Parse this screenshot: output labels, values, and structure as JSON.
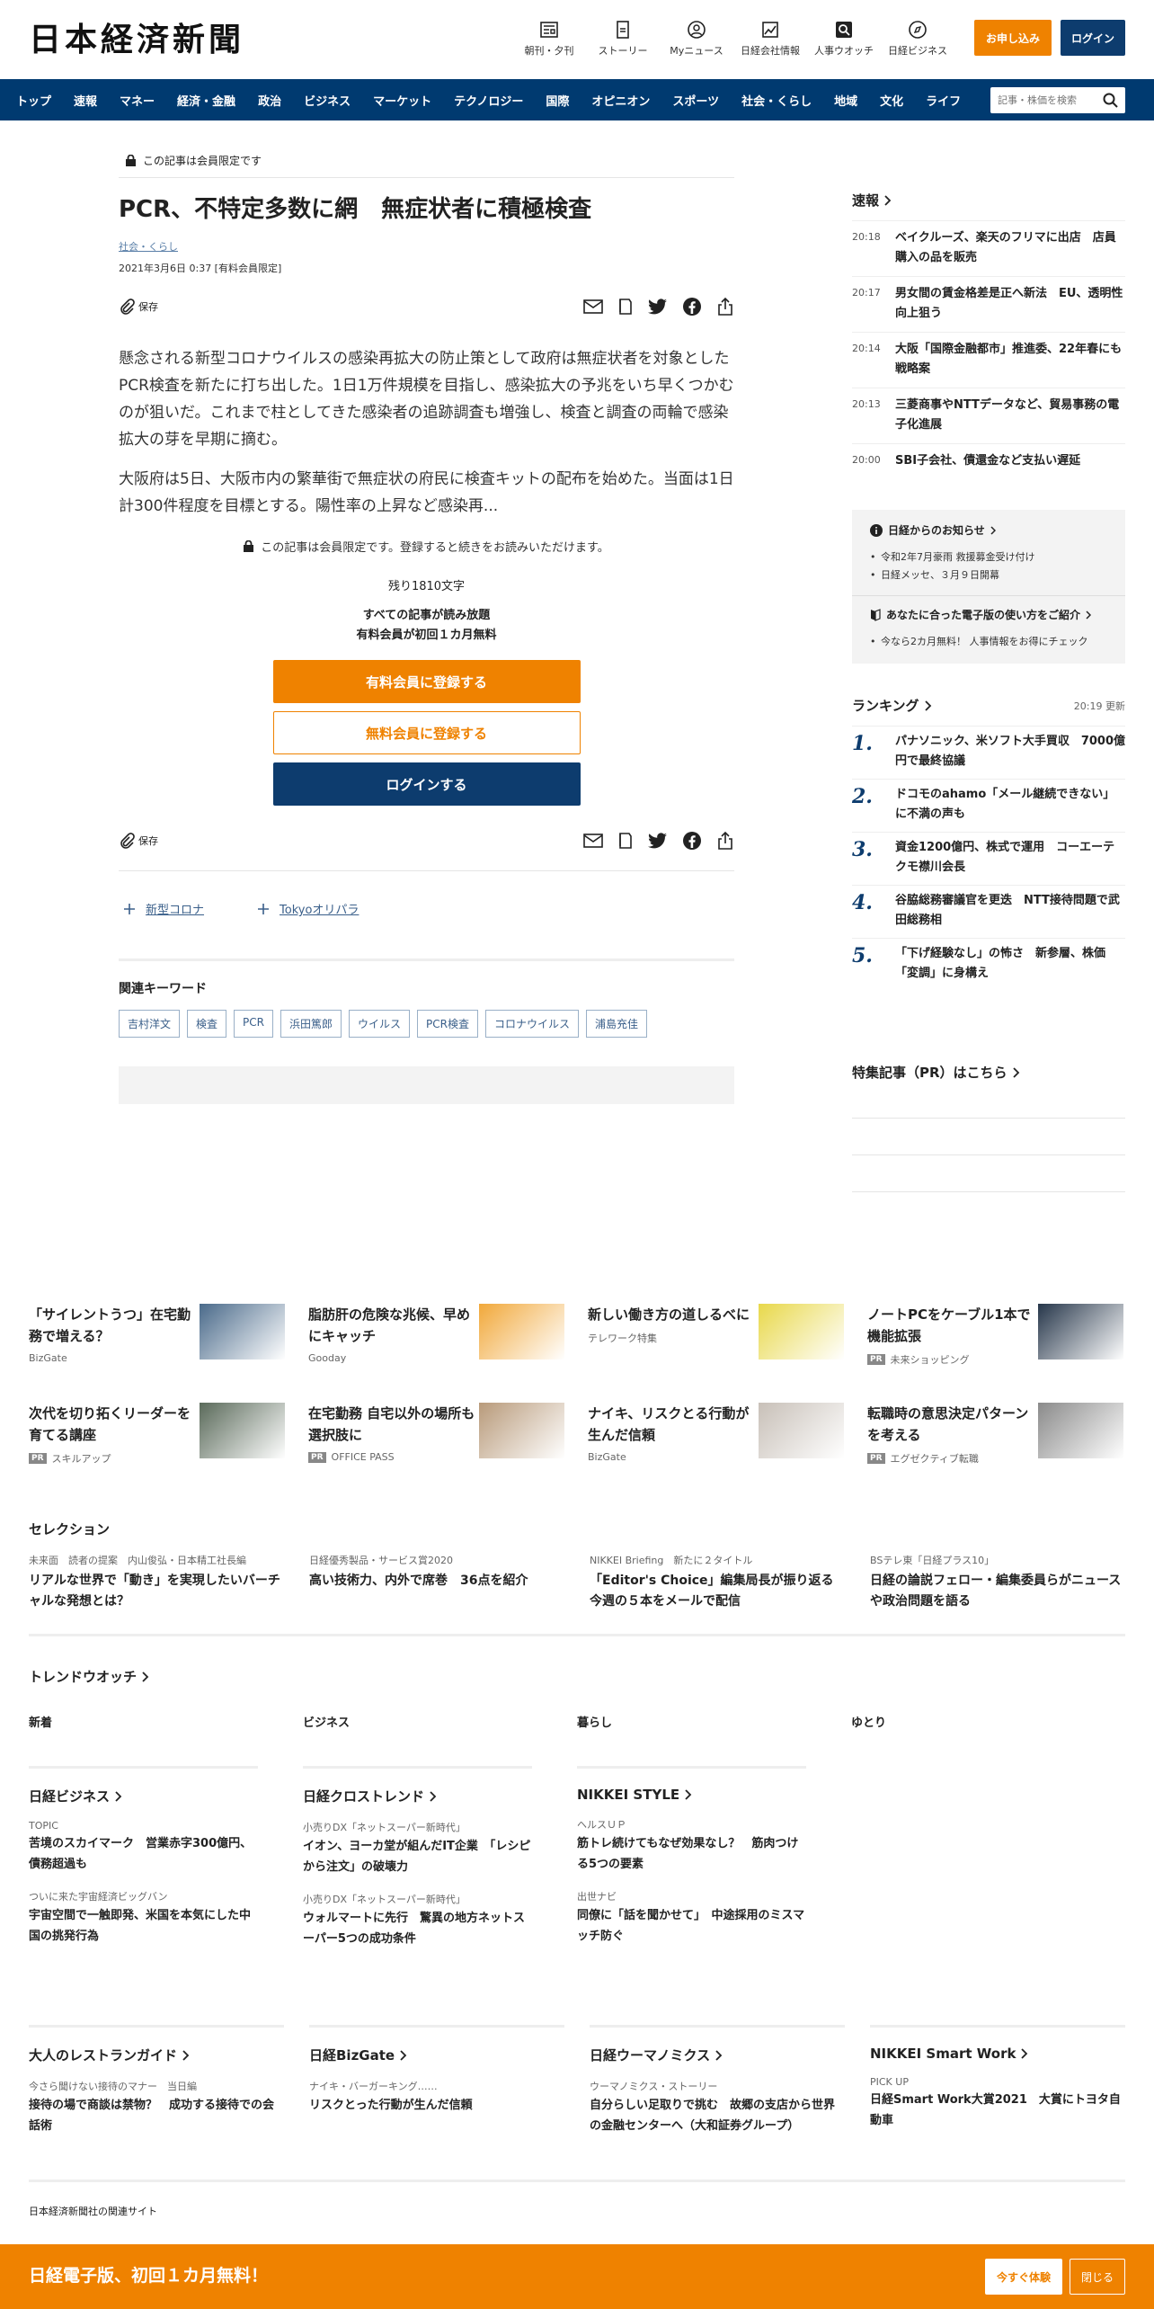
{
  "header": {
    "logo": "日本経済新聞",
    "tools": [
      {
        "label": "朝刊・夕刊",
        "icon": "newspaper-icon"
      },
      {
        "label": "ストーリー",
        "icon": "story-icon"
      },
      {
        "label": "Myニュース",
        "icon": "user-icon"
      },
      {
        "label": "日経会社情報",
        "icon": "chart-icon"
      },
      {
        "label": "人事ウオッチ",
        "icon": "search-person-icon"
      },
      {
        "label": "日経ビジネス",
        "icon": "compass-icon"
      }
    ],
    "apply_label": "お申し込み",
    "login_label": "ログイン"
  },
  "nav": {
    "items": [
      "トップ",
      "速報",
      "マネー",
      "経済・金融",
      "政治",
      "ビジネス",
      "マーケット",
      "テクノロジー",
      "国際",
      "オピニオン",
      "スポーツ",
      "社会・くらし",
      "地域",
      "文化",
      "ライフ"
    ],
    "search_placeholder": "記事・株価を検索"
  },
  "article": {
    "member_only": "この記事は会員限定です",
    "title": "PCR、不特定多数に網　無症状者に積極検査",
    "category": "社会・くらし",
    "date": "2021年3月6日 0:37 [有料会員限定]",
    "save_label": "保存",
    "para1": "懸念される新型コロナウイルスの感染再拡大の防止策として政府は無症状者を対象としたPCR検査を新たに打ち出した。1日1万件規模を目指し、感染拡大の予兆をいち早くつかむのが狙いだ。これまで柱としてきた感染者の追跡調査も増強し、検査と調査の両輪で感染拡大の芽を早期に摘む。",
    "para2": "大阪府は5日、大阪市内の繁華街で無症状の府民に検査キットの配布を始めた。当面は1日計300件程度を目標とする。陽性率の上昇など感染再...",
    "lock_note": "この記事は会員限定です。登録すると続きをお読みいただけます。",
    "remaining": "残り1810文字",
    "all_read_1": "すべての記事が読み放題",
    "all_read_2": "有料会員が初回１カ月無料",
    "cta_paid": "有料会員に登録する",
    "cta_free": "無料会員に登録する",
    "cta_login": "ログインする",
    "follow": [
      "新型コロナ",
      "Tokyoオリパラ"
    ],
    "keywords_title": "関連キーワード",
    "keywords": [
      "吉村洋文",
      "検査",
      "PCR",
      "浜田篤郎",
      "ウイルス",
      "PCR検査",
      "コロナウイルス",
      "浦島充佳"
    ]
  },
  "sidebar": {
    "flash_title": "速報",
    "flash": [
      {
        "time": "20:18",
        "headline": "ベイクルーズ、楽天のフリマに出店　店員購入の品を販売"
      },
      {
        "time": "20:17",
        "headline": "男女間の賃金格差是正へ新法　EU、透明性向上狙う"
      },
      {
        "time": "20:14",
        "headline": "大阪「国際金融都市」推進委、22年春にも戦略案"
      },
      {
        "time": "20:13",
        "headline": "三菱商事やNTTデータなど、貿易事務の電子化進展"
      },
      {
        "time": "20:00",
        "headline": "SBI子会社、債還金など支払い遅延"
      }
    ],
    "notice_title": "日経からのお知らせ",
    "notices": [
      "令和2年7月豪雨 救援募金受け付け",
      "日経メッセ、３月９日開幕"
    ],
    "guide_title": "あなたに合った電子版の使い方をご紹介",
    "guides": [
      "今なら2カ月無料！ 人事情報をお得にチェック"
    ],
    "ranking_title": "ランキング",
    "ranking_updated": "20:19  更新",
    "ranking": [
      {
        "n": "1.",
        "headline": "パナソニック、米ソフト大手買収　7000億円で最終協議"
      },
      {
        "n": "2.",
        "headline": "ドコモのahamo「メール継続できない」に不満の声も"
      },
      {
        "n": "3.",
        "headline": "資金1200億円、株式で運用　コーエーテクモ襟川会長"
      },
      {
        "n": "4.",
        "headline": "谷脇総務審議官を更迭　NTT接待問題で武田総務相"
      },
      {
        "n": "5.",
        "headline": "「下げ経験なし」の怖さ　新参層、株価「変調」に身構え"
      }
    ],
    "pr_title": "特集記事（PR）はこちら"
  },
  "promos": [
    [
      {
        "headline": "「サイレントうつ」在宅勤務で増える？",
        "source": "BizGate",
        "pr": false,
        "color": "#4a6a8a"
      },
      {
        "headline": "脂肪肝の危険な兆候、早めにキャッチ",
        "source": "Gooday",
        "pr": false,
        "color": "#f1a83a"
      },
      {
        "headline": "新しい働き方の道しるべに",
        "source": "テレワーク特集",
        "pr": false,
        "color": "#e8d84a"
      },
      {
        "headline": "ノートPCをケーブル1本で機能拡張",
        "source": "未来ショッピング",
        "pr": true,
        "color": "#26364a"
      }
    ],
    [
      {
        "headline": "次代を切り拓くリーダーを育てる講座",
        "source": "スキルアップ",
        "pr": true,
        "color": "#5a6a5a"
      },
      {
        "headline": "在宅勤務 自宅以外の場所も選択肢に",
        "source": "OFFICE PASS",
        "pr": true,
        "color": "#b89a7a"
      },
      {
        "headline": "ナイキ、リスクとる行動が生んだ信頼",
        "source": "BizGate",
        "pr": false,
        "color": "#c8c0b8"
      },
      {
        "headline": "転職時の意思決定パターンを考える",
        "source": "エグゼクティブ転職",
        "pr": true,
        "color": "#8a8a8a"
      }
    ]
  ],
  "pr_badge": "PR",
  "selection": {
    "title": "セレクション",
    "items": [
      {
        "kicker": "未来面　読者の提案　内山俊弘・日本精工社長編",
        "headline": "リアルな世界で「動き」を実現したいバーチャルな発想とは？"
      },
      {
        "kicker": "日経優秀製品・サービス賞2020",
        "headline": "高い技術力、内外で席巻　36点を紹介"
      },
      {
        "kicker": "NIKKEI Briefing　新たに２タイトル",
        "headline": "「Editor's Choice」編集局長が振り返る今週の５本をメールで配信"
      },
      {
        "kicker": "BSテレ東「日経プラス10」",
        "headline": "日経の論説フェロー・編集委員らがニュースや政治問題を語る"
      }
    ]
  },
  "trend": {
    "title": "トレンドウオッチ",
    "tabs": [
      "新着",
      "ビジネス",
      "暮らし",
      "ゆとり"
    ],
    "cols": [
      {
        "title": "日経ビジネス",
        "items": [
          {
            "kicker": "TOPIC",
            "headline": "苦境のスカイマーク　営業赤字300億円、債務超過も"
          },
          {
            "kicker": "ついに来た宇宙経済ビッグバン",
            "headline": "宇宙空間で一触即発、米国を本気にした中国の挑発行為"
          }
        ]
      },
      {
        "title": "日経クロストレンド",
        "items": [
          {
            "kicker": "小売りDX「ネットスーパー新時代」",
            "headline": "イオン、ヨーカ堂が組んだIT企業　「レシピから注文」の破壊力"
          },
          {
            "kicker": "小売りDX「ネットスーパー新時代」",
            "headline": "ウォルマートに先行　驚異の地方ネットスーパー5つの成功条件"
          }
        ]
      },
      {
        "title": "NIKKEI STYLE",
        "items": [
          {
            "kicker": "ヘルスＵＰ",
            "headline": "筋トレ続けてもなぜ効果なし？　筋肉つける5つの要素"
          },
          {
            "kicker": "出世ナビ",
            "headline": "同僚に「話を聞かせて」　中途採用のミスマッチ防ぐ"
          }
        ]
      }
    ]
  },
  "sites": [
    {
      "title": "大人のレストランガイド",
      "kicker": "今さら聞けない接待のマナー　当日編",
      "headline": "接待の場で商談は禁物？　成功する接待での会話術"
    },
    {
      "title": "日経BizGate",
      "kicker": "ナイキ・バーガーキング……",
      "headline": "リスクとった行動が生んだ信頼"
    },
    {
      "title": "日経ウーマノミクス",
      "kicker": "ウーマノミクス・ストーリー",
      "headline": "自分らしい足取りで挑む　故郷の支店から世界の金融センターへ（大和証券グループ）"
    },
    {
      "title": "NIKKEI Smart Work",
      "kicker": "PICK UP",
      "headline": "日経Smart Work大賞2021　大賞にトヨタ自動車"
    }
  ],
  "related_sites": "日本経済新聞社の関連サイト",
  "footer": {
    "text": "日経電子版、初回１カ月無料！",
    "try_label": "今すぐ体験",
    "close_label": "閉じる"
  }
}
